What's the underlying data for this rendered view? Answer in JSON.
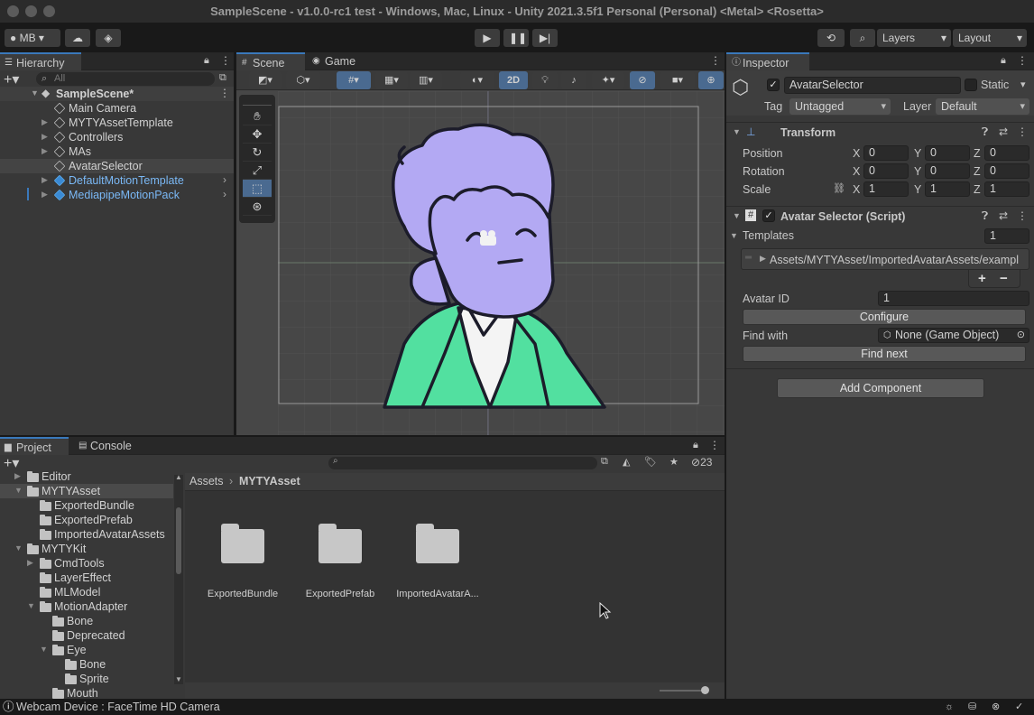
{
  "window": {
    "title": "SampleScene - v1.0.0-rc1 test - Windows, Mac, Linux - Unity 2021.3.5f1 Personal (Personal) <Metal> <Rosetta>"
  },
  "toolbar": {
    "account": "MB",
    "layers": "Layers",
    "layout": "Layout"
  },
  "hierarchy": {
    "tab": "Hierarchy",
    "search_placeholder": "All",
    "scene": "SampleScene*",
    "items": [
      {
        "label": "Main Camera",
        "prefab": false,
        "expandable": false
      },
      {
        "label": "MYTYAssetTemplate",
        "prefab": false,
        "expandable": true
      },
      {
        "label": "Controllers",
        "prefab": false,
        "expandable": true
      },
      {
        "label": "MAs",
        "prefab": false,
        "expandable": true
      },
      {
        "label": "AvatarSelector",
        "prefab": false,
        "expandable": false,
        "selected": true
      },
      {
        "label": "DefaultMotionTemplate",
        "prefab": true,
        "expandable": true
      },
      {
        "label": "MediapipeMotionPack",
        "prefab": true,
        "expandable": true
      }
    ]
  },
  "scene_view": {
    "tabs": [
      "Scene",
      "Game"
    ],
    "mode_2d": "2D"
  },
  "inspector": {
    "tab": "Inspector",
    "object_name": "AvatarSelector",
    "static_label": "Static",
    "tag_label": "Tag",
    "tag_value": "Untagged",
    "layer_label": "Layer",
    "layer_value": "Default",
    "transform": {
      "title": "Transform",
      "rows": [
        {
          "label": "Position",
          "x": "0",
          "y": "0",
          "z": "0"
        },
        {
          "label": "Rotation",
          "x": "0",
          "y": "0",
          "z": "0"
        },
        {
          "label": "Scale",
          "x": "1",
          "y": "1",
          "z": "1"
        }
      ],
      "axis_x": "X",
      "axis_y": "Y",
      "axis_z": "Z"
    },
    "script": {
      "title": "Avatar Selector (Script)",
      "templates_label": "Templates",
      "templates_count": "1",
      "template_path": "Assets/MYTYAsset/ImportedAvatarAssets/exampl",
      "plus": "+",
      "minus": "−",
      "avatar_id_label": "Avatar ID",
      "avatar_id_value": "1",
      "configure": "Configure",
      "find_with_label": "Find with",
      "find_with_value": "None (Game Object)",
      "find_next": "Find next"
    },
    "add_component": "Add Component"
  },
  "project": {
    "tabs": [
      "Project",
      "Console"
    ],
    "hidden_count": "23",
    "breadcrumb": [
      "Assets",
      "MYTYAsset"
    ],
    "tree": [
      {
        "label": "Editor",
        "depth": 1,
        "expanded": false,
        "arrow": true
      },
      {
        "label": "MYTYAsset",
        "depth": 1,
        "expanded": true,
        "arrow": true,
        "selected": true
      },
      {
        "label": "ExportedBundle",
        "depth": 2,
        "arrow": false
      },
      {
        "label": "ExportedPrefab",
        "depth": 2,
        "arrow": false
      },
      {
        "label": "ImportedAvatarAssets",
        "depth": 2,
        "arrow": false
      },
      {
        "label": "MYTYKit",
        "depth": 1,
        "expanded": true,
        "arrow": true
      },
      {
        "label": "CmdTools",
        "depth": 2,
        "expanded": false,
        "arrow": true
      },
      {
        "label": "LayerEffect",
        "depth": 2,
        "arrow": false
      },
      {
        "label": "MLModel",
        "depth": 2,
        "arrow": false
      },
      {
        "label": "MotionAdapter",
        "depth": 2,
        "expanded": true,
        "arrow": true
      },
      {
        "label": "Bone",
        "depth": 3,
        "arrow": false
      },
      {
        "label": "Deprecated",
        "depth": 3,
        "arrow": false
      },
      {
        "label": "Eye",
        "depth": 3,
        "expanded": true,
        "arrow": true
      },
      {
        "label": "Bone",
        "depth": 4,
        "arrow": false
      },
      {
        "label": "Sprite",
        "depth": 4,
        "arrow": false
      },
      {
        "label": "Mouth",
        "depth": 3,
        "arrow": false
      }
    ],
    "assets": [
      "ExportedBundle",
      "ExportedPrefab",
      "ImportedAvatarA..."
    ]
  },
  "status": {
    "text": "Webcam Device : FaceTime HD Camera"
  },
  "colors": {
    "accent": "#3a79bb",
    "prefab_blue": "#5fb0f2",
    "character_face": "#b3a9f3",
    "jacket_green": "#52e0a0"
  }
}
